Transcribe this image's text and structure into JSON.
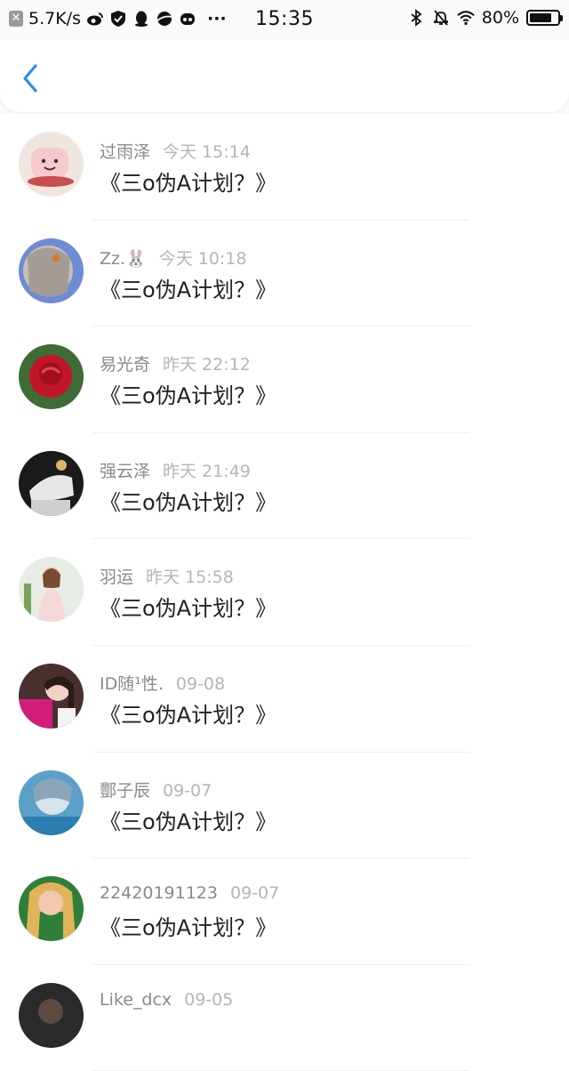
{
  "status": {
    "speed": "5.7K/s",
    "time": "15:35",
    "battery": "80%",
    "battery_level": 0.8,
    "more": "···"
  },
  "nav": {
    "back_icon": "chevron-left-icon"
  },
  "colors": {
    "accent": "#2d8cf0",
    "name": "#8a8a8a",
    "time": "#b5b5b5",
    "message": "#222222"
  },
  "messages": [
    {
      "name": "过雨泽",
      "time": "今天 15:14",
      "text": "《三o伪A计划？》",
      "avatar": "cup-avatar"
    },
    {
      "name": "Zz.🐰",
      "time": "今天 10:18",
      "text": "《三o伪A计划？》",
      "avatar": "anime-avatar"
    },
    {
      "name": "易光奇",
      "time": "昨天 22:12",
      "text": "《三o伪A计划？》",
      "avatar": "rose-avatar"
    },
    {
      "name": "强云泽",
      "time": "昨天 21:49",
      "text": "《三o伪A计划？》",
      "avatar": "statue-avatar"
    },
    {
      "name": "羽运",
      "time": "昨天 15:58",
      "text": "《三o伪A计划？》",
      "avatar": "woman-avatar"
    },
    {
      "name": "ID随¹性.",
      "time": "09-08",
      "text": "《三o伪A计划？》",
      "avatar": "girl-avatar"
    },
    {
      "name": "酆子辰",
      "time": "09-07",
      "text": "《三o伪A计划？》",
      "avatar": "face-avatar"
    },
    {
      "name": "22420191123",
      "time": "09-07",
      "text": "《三o伪A计划？》",
      "avatar": "blonde-avatar"
    },
    {
      "name": "Like_dcx",
      "time": "09-05",
      "text": "",
      "avatar": "dark-avatar"
    }
  ]
}
